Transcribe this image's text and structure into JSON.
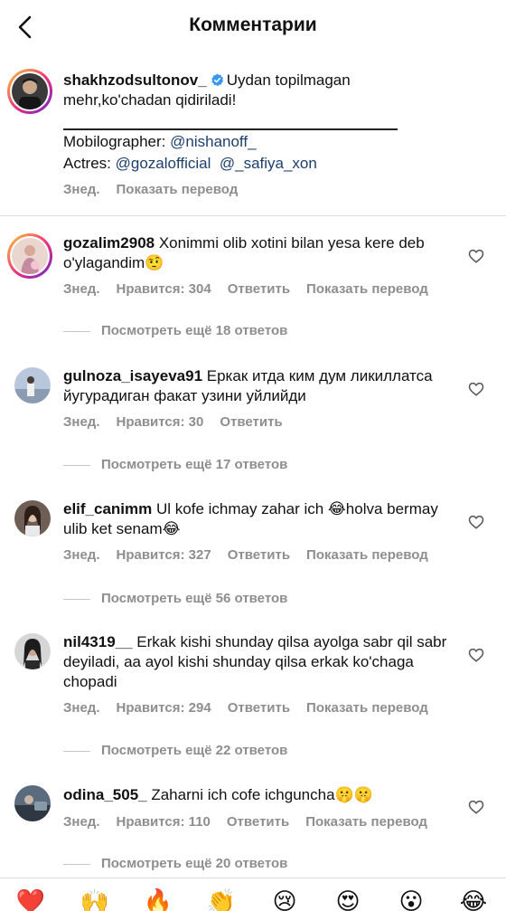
{
  "header": {
    "title": "Комментарии"
  },
  "caption": {
    "username": "shakhzodsultonov_",
    "text": "Uydan topilmagan mehr,ko'chadan qidiriladi!",
    "mobilographer_label": "Mobilographer: ",
    "mobilographer_handle": "@nishanoff_",
    "actres_label": "Actres: ",
    "actres_handle_1": "@gozalofficial",
    "actres_handle_2": "@_safiya_xon",
    "time": "Знед.",
    "translate": "Показать перевод"
  },
  "comments": [
    {
      "username": "gozalim2908",
      "text": "Xonimmi olib xotini bilan yesa kere deb o'ylagandim",
      "emoji": "🤨",
      "time": "Знед.",
      "likes": "Нравится: 304",
      "reply": "Ответить",
      "translate": "Показать перевод",
      "view_replies": "Посмотреть ещё 18 ответов"
    },
    {
      "username": "gulnoza_isayeva91",
      "text": "Еркак итда ким дум ликиллатса йугурадиган факат узини уйлийди",
      "emoji": "",
      "time": "Знед.",
      "likes": "Нравится: 30",
      "reply": "Ответить",
      "translate": "",
      "view_replies": "Посмотреть ещё 17 ответов"
    },
    {
      "username": "elif_canimm",
      "text_a": "Ul kofe ichmay zahar ich ",
      "emoji_a": "😂",
      "text_b": "holva bermay ulib ket senam",
      "emoji_b": "😂",
      "time": "Знед.",
      "likes": "Нравится: 327",
      "reply": "Ответить",
      "translate": "Показать перевод",
      "view_replies": "Посмотреть ещё 56 ответов"
    },
    {
      "username": "nil4319__",
      "text": "Erkak kishi shunday qilsa ayolga sabr qil sabr deyiladi, aa ayol kishi shunday qilsa erkak ko'chaga chopadi",
      "emoji": "",
      "time": "Знед.",
      "likes": "Нравится: 294",
      "reply": "Ответить",
      "translate": "Показать перевод",
      "view_replies": "Посмотреть ещё 22 ответов"
    },
    {
      "username": "odina_505_",
      "text": "Zaharni ich cofe ichguncha",
      "emoji": "🤫🤫",
      "time": "Знед.",
      "likes": "Нравится: 110",
      "reply": "Ответить",
      "translate": "Показать перевод",
      "view_replies": "Посмотреть ещё 20 ответов"
    }
  ],
  "emoji_bar": [
    "❤️",
    "🙌",
    "🔥",
    "👏",
    "😢",
    "😍",
    "😮",
    "😂"
  ],
  "colors": {
    "link": "#1c3f6e",
    "meta": "#8e8e8e",
    "verified": "#3897f0"
  }
}
